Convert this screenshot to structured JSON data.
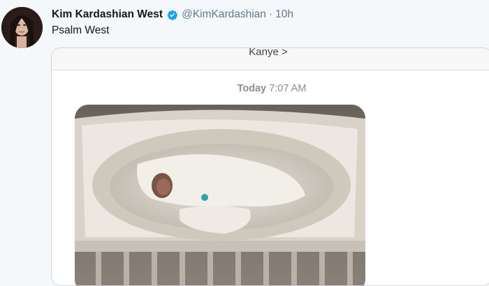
{
  "tweet": {
    "display_name": "Kim Kardashian West",
    "handle": "@KimKardashian",
    "separator": "·",
    "time": "10h",
    "text": "Psalm West",
    "verified": true
  },
  "message_card": {
    "contact_name": "Kanye >",
    "timestamp_day": "Today",
    "timestamp_time": "7:07 AM"
  },
  "colors": {
    "verified_blue": "#1da1f2",
    "handle_gray": "#657786",
    "page_background": "#f5f8fa"
  },
  "icons": [
    "verified-badge-icon"
  ]
}
